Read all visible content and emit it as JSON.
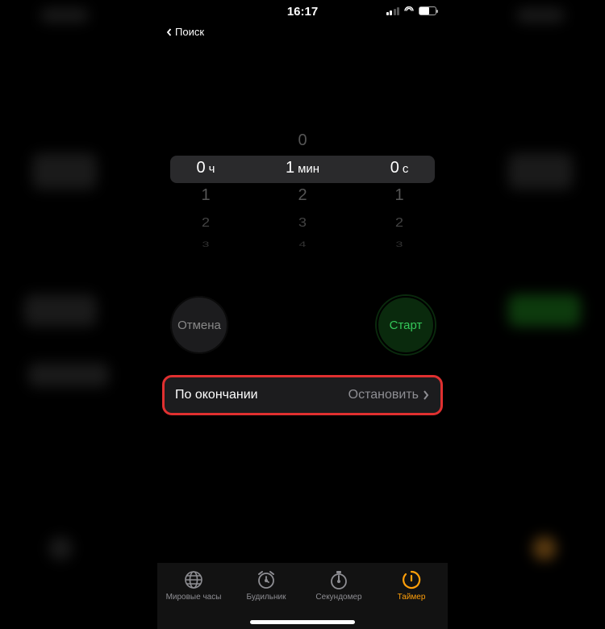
{
  "status": {
    "time": "16:17",
    "back_label": "Поиск"
  },
  "picker": {
    "hours": {
      "selected": "0",
      "unit": "ч",
      "below": [
        "1",
        "2",
        "3"
      ]
    },
    "minutes": {
      "above": "0",
      "selected": "1",
      "unit": "мин",
      "below": [
        "2",
        "3",
        "4"
      ]
    },
    "seconds": {
      "selected": "0",
      "unit": "с",
      "below": [
        "1",
        "2",
        "3"
      ]
    }
  },
  "buttons": {
    "cancel_label": "Отмена",
    "start_label": "Старт"
  },
  "end_sound": {
    "label": "По окончании",
    "value": "Остановить"
  },
  "tabs": {
    "worldclock": "Мировые часы",
    "alarm": "Будильник",
    "stopwatch": "Секундомер",
    "timer": "Таймер"
  }
}
